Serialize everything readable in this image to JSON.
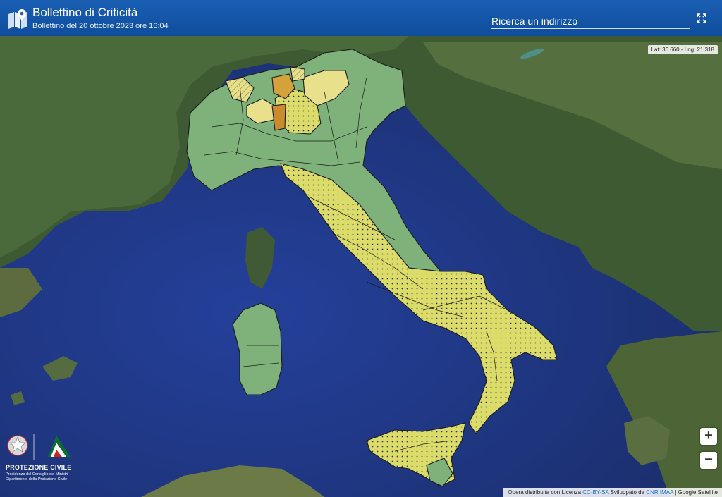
{
  "header": {
    "title": "Bollettino di Criticità",
    "subtitle": "Bollettino del 20 ottobre 2023 ore 16:04",
    "search_placeholder": "Ricerca un indirizzo",
    "logo_icon": "map-pin-icon",
    "fullscreen_icon": "fullscreen-icon"
  },
  "map": {
    "coords": "Lat: 36.660 - Lng: 21.318",
    "zoom_in": "+",
    "zoom_out": "−",
    "layer": "satellite",
    "colors": {
      "green": "#7fb27a",
      "yellow": "#dcdc6b",
      "light_yellow": "#e8e08a",
      "orange": "#d4a23a",
      "sea": "#233f8c",
      "land": "#3f5a34"
    }
  },
  "attribution": {
    "prefix": "Opera distribuita con Licenza",
    "license": "CC-BY-SA",
    "developed": "Sviluppato da",
    "developer": "CNR IMAA",
    "sep": "|",
    "tiles": "Google Satellite"
  },
  "branding": {
    "name": "PROTEZIONE CIVILE",
    "line1": "Presidenza del Consiglio dei Ministri",
    "line2": "Dipartimento della Protezione Civile",
    "emblem_icon": "republic-emblem-icon",
    "logo_icon": "protezione-civile-logo-icon"
  }
}
